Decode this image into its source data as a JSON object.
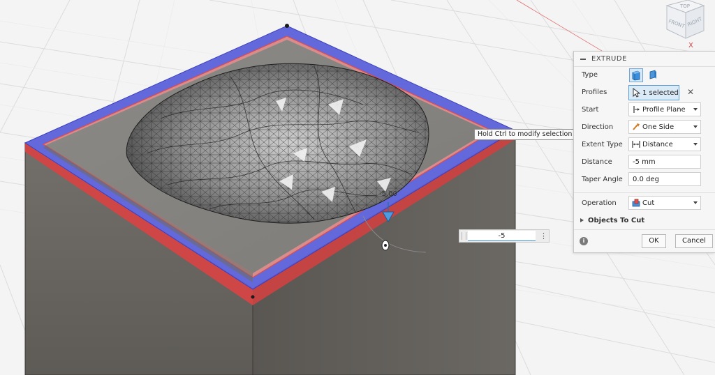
{
  "viewcube": {
    "faces": [
      "TOP",
      "FRONT",
      "RIGHT"
    ],
    "axis_label": "X"
  },
  "tooltip": "Hold Ctrl to modify selection",
  "manipulator_label": "-5.00",
  "canvas_input": {
    "value": "-5",
    "menu_icon": "vertical-ellipsis-icon"
  },
  "extrude_panel": {
    "title": "EXTRUDE",
    "rows": {
      "type": {
        "label": "Type",
        "icons": [
          "solid-extrude-icon",
          "surface-extrude-icon"
        ],
        "selected": "solid"
      },
      "profiles": {
        "label": "Profiles",
        "value": "1 selected",
        "icon": "cursor-select-icon",
        "clear_icon": "x-icon"
      },
      "start": {
        "label": "Start",
        "value": "Profile Plane",
        "icon": "profile-plane-icon"
      },
      "direction": {
        "label": "Direction",
        "value": "One Side",
        "icon": "one-side-icon"
      },
      "extent_type": {
        "label": "Extent Type",
        "value": "Distance",
        "icon": "distance-icon"
      },
      "distance": {
        "label": "Distance",
        "value": "-5 mm"
      },
      "taper_angle": {
        "label": "Taper Angle",
        "value": "0.0 deg"
      },
      "operation": {
        "label": "Operation",
        "value": "Cut",
        "icon": "cut-operation-icon"
      }
    },
    "objects_to_cut": "Objects To Cut",
    "ok_label": "OK",
    "cancel_label": "Cancel"
  },
  "colors": {
    "accent_blue": "#3d8fd6",
    "selection_blue": "#5a60d6",
    "selection_red": "#d94a4a",
    "body_gray": "#6c6965",
    "face_gray": "#8a8884"
  }
}
